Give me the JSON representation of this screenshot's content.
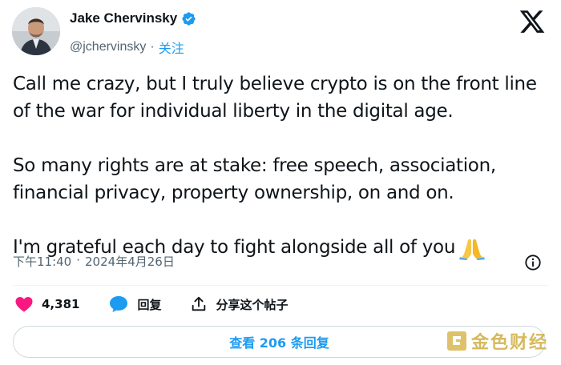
{
  "author": {
    "name": "Jake Chervinsky",
    "handle": "@jchervinsky",
    "separator": "·",
    "follow_label": "关注"
  },
  "tweet": {
    "paragraphs": [
      "Call me crazy, but I truly believe crypto is on the front line of the war for individual liberty in the digital age.",
      "So many rights are at stake: free speech, association, financial privacy, property ownership, on and on.",
      "I'm grateful each day to fight alongside all of you"
    ],
    "emoji": "folded-hands"
  },
  "meta": {
    "time": "下午11:40",
    "separator": "·",
    "date": "2024年4月26日"
  },
  "actions": {
    "likes": "4,381",
    "reply_label": "回复",
    "share_label": "分享这个帖子"
  },
  "replies_button": "查看 206 条回复",
  "watermark": "金色财经",
  "colors": {
    "accent": "#1d9bf0",
    "like": "#f91880",
    "text": "#0f1419",
    "muted": "#536471"
  },
  "icons": [
    "verified-badge-icon",
    "x-logo-icon",
    "info-icon",
    "heart-icon",
    "reply-bubble-icon",
    "share-icon"
  ]
}
